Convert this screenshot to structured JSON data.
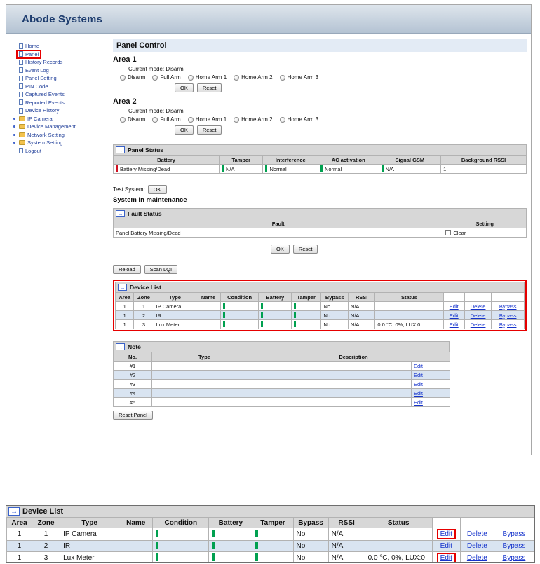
{
  "colors": {
    "highlight_red": "#e60000",
    "status_green": "#00a050",
    "status_red": "#cf1020",
    "link_blue": "#1533cc",
    "title_navy": "#1d3c6e",
    "row_alt_blue": "#d9e4f1",
    "header_gray": "#d7d7d7"
  },
  "app": {
    "title": "Abode Systems"
  },
  "sidebar": {
    "items": [
      {
        "label": "Home",
        "icon": "page-icon"
      },
      {
        "label": "Panel",
        "icon": "page-icon",
        "highlighted": true
      },
      {
        "label": "History Records",
        "icon": "page-icon"
      },
      {
        "label": "Event Log",
        "icon": "page-icon"
      },
      {
        "label": "Panel Setting",
        "icon": "page-icon"
      },
      {
        "label": "PIN Code",
        "icon": "page-icon"
      },
      {
        "label": "Captured Events",
        "icon": "page-icon"
      },
      {
        "label": "Reported Events",
        "icon": "page-icon"
      },
      {
        "label": "Device History",
        "icon": "page-icon"
      },
      {
        "label": "IP Camera",
        "icon": "folder-icon",
        "expandable": true
      },
      {
        "label": "Device Management",
        "icon": "folder-icon",
        "expandable": true
      },
      {
        "label": "Network Setting",
        "icon": "folder-icon",
        "expandable": true
      },
      {
        "label": "System Setting",
        "icon": "folder-icon",
        "expandable": true
      },
      {
        "label": "Logout",
        "icon": "page-icon"
      }
    ]
  },
  "panel_control": {
    "title": "Panel Control",
    "areas": [
      {
        "name": "Area 1",
        "mode_label": "Current mode: Disarm",
        "options": [
          "Disarm",
          "Full Arm",
          "Home Arm 1",
          "Home Arm 2",
          "Home Arm 3"
        ],
        "ok_label": "OK",
        "reset_label": "Reset"
      },
      {
        "name": "Area 2",
        "mode_label": "Current mode: Disarm",
        "options": [
          "Disarm",
          "Full Arm",
          "Home Arm 1",
          "Home Arm 2",
          "Home Arm 3"
        ],
        "ok_label": "OK",
        "reset_label": "Reset"
      }
    ]
  },
  "panel_status": {
    "title": "Panel Status",
    "headers": [
      "Battery",
      "Tamper",
      "Interference",
      "AC activation",
      "Signal GSM",
      "Background RSSI"
    ],
    "row": {
      "battery": "Battery Missing/Dead",
      "tamper": "N/A",
      "interference": "Normal",
      "ac_activation": "Normal",
      "signal_gsm": "N/A",
      "background_rssi": "1"
    }
  },
  "test_system": {
    "label": "Test System:",
    "ok_label": "OK",
    "maintenance_text": "System in maintenance"
  },
  "fault_status": {
    "title": "Fault Status",
    "headers": {
      "fault": "Fault",
      "setting": "Setting"
    },
    "rows": [
      {
        "fault": "Panel Battery Missing/Dead",
        "setting_label": "Clear",
        "checked": false
      }
    ],
    "ok_label": "OK",
    "reset_label": "Reset"
  },
  "toolbar": {
    "reload_label": "Reload",
    "scan_lqi_label": "Scan LQI",
    "reset_panel_label": "Reset Panel"
  },
  "device_list": {
    "title": "Device List",
    "headers": [
      "Area",
      "Zone",
      "Type",
      "Name",
      "Condition",
      "Battery",
      "Tamper",
      "Bypass",
      "RSSI",
      "Status"
    ],
    "action_labels": [
      "Edit",
      "Delete",
      "Bypass"
    ],
    "rows": [
      {
        "area": "1",
        "zone": "1",
        "type": "IP Camera",
        "name": "",
        "condition": "green",
        "battery": "green",
        "tamper": "green",
        "bypass": "No",
        "rssi": "N/A",
        "status": ""
      },
      {
        "area": "1",
        "zone": "2",
        "type": "IR",
        "name": "",
        "condition": "green",
        "battery": "green",
        "tamper": "green",
        "bypass": "No",
        "rssi": "N/A",
        "status": ""
      },
      {
        "area": "1",
        "zone": "3",
        "type": "Lux Meter",
        "name": "",
        "condition": "green",
        "battery": "green",
        "tamper": "green",
        "bypass": "No",
        "rssi": "N/A",
        "status": "0.0 °C, 0%, LUX:0"
      }
    ]
  },
  "note": {
    "title": "Note",
    "headers": [
      "No.",
      "Type",
      "Description"
    ],
    "edit_label": "Edit",
    "rows": [
      {
        "no": "#1",
        "type": "",
        "description": ""
      },
      {
        "no": "#2",
        "type": "",
        "description": ""
      },
      {
        "no": "#3",
        "type": "",
        "description": ""
      },
      {
        "no": "#4",
        "type": "",
        "description": ""
      },
      {
        "no": "#5",
        "type": "",
        "description": ""
      }
    ]
  },
  "annotations": {
    "sidebar_highlighted_item": "Panel",
    "device_list_outlined": true,
    "zoom_edit_red_box_rows": [
      0,
      2
    ]
  }
}
